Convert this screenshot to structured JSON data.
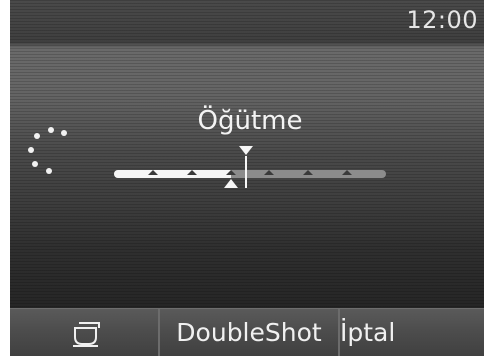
{
  "status": {
    "clock": "12:00"
  },
  "setting": {
    "title": "Öğütme",
    "steps": 7,
    "current_level": 3,
    "target_level": 3.4
  },
  "softkeys": {
    "cup_icon": "cup-icon",
    "double_label": "DoubleShot",
    "cancel_label": "İptal"
  },
  "colors": {
    "text": "#f0f0f0",
    "track": "#8c8c8c",
    "fill": "#f6f6f6",
    "background": "#303030"
  }
}
